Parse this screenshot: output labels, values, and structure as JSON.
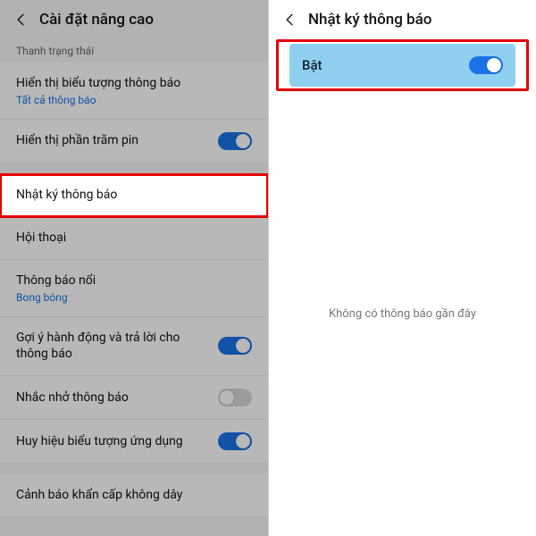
{
  "left": {
    "title": "Cài đặt nâng cao",
    "section": "Thanh trạng thái",
    "rows": {
      "show_icons": {
        "label": "Hiển thị biểu tượng thông báo",
        "sub": "Tất cả thông báo"
      },
      "battery_pct": {
        "label": "Hiển thị phần trăm pin"
      },
      "notif_log": {
        "label": "Nhật ký thông báo"
      },
      "conversation": {
        "label": "Hội thoại"
      },
      "floating": {
        "label": "Thông báo nổi",
        "sub": "Bong bóng"
      },
      "suggest": {
        "label": "Gợi ý hành động và trả lời cho thông báo"
      },
      "remind": {
        "label": "Nhắc nhở thông báo"
      },
      "badge": {
        "label": "Huy hiệu biểu tượng ứng dụng"
      },
      "emergency": {
        "label": "Cảnh báo khẩn cấp không dây"
      }
    }
  },
  "right": {
    "title": "Nhật ký thông báo",
    "enable_label": "Bật",
    "empty_msg": "Không có thông báo gần đây"
  }
}
